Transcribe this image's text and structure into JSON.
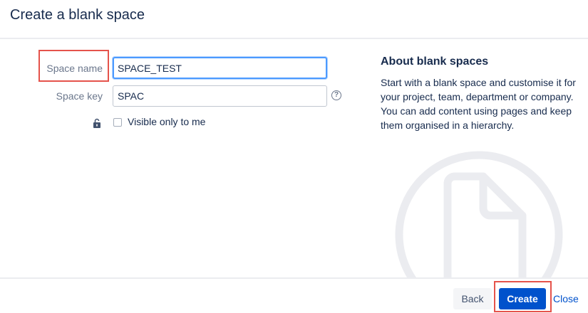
{
  "dialog": {
    "title": "Create a blank space"
  },
  "form": {
    "space_name": {
      "label": "Space name",
      "value": "SPACE_TEST"
    },
    "space_key": {
      "label": "Space key",
      "value": "SPAC",
      "help_icon": "question-circle-icon"
    },
    "visibility": {
      "lock_icon": "unlock-icon",
      "label": "Visible only to me",
      "checked": false
    }
  },
  "about": {
    "title": "About blank spaces",
    "text": "Start with a blank space and customise it for your project, team, department or company. You can add content using pages and keep them organised in a hierarchy."
  },
  "footer": {
    "back_label": "Back",
    "create_label": "Create",
    "close_label": "Close"
  },
  "colors": {
    "primary": "#0052cc",
    "highlight": "#e5534b",
    "focus": "#4c9aff"
  }
}
